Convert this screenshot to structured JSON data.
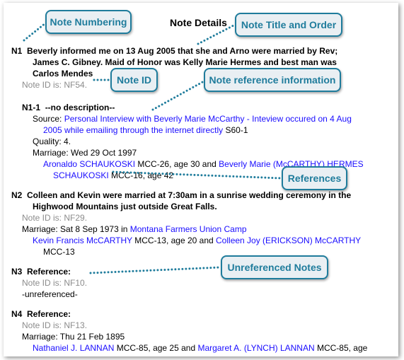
{
  "title": "Note Details",
  "callouts": {
    "numbering": "Note Numbering",
    "title_order": "Note Title and Order",
    "note_id": "Note ID",
    "ref_info": "Note reference information",
    "references": "References",
    "unreferenced": "Unreferenced Notes"
  },
  "colors": {
    "callout_border": "#1f7c9c",
    "callout_fill": "#e9eff3",
    "link": "#1a0dff",
    "note_id": "#8c8c8c"
  },
  "n1": {
    "num": "N1",
    "l1": "Beverly informed me on 13 Aug 2005 that she and Arno were married by Rev;",
    "l2": "James C. Gibney. Maid of Honor was Kelly Marie Hermes and best man was",
    "l3": "Carlos Mendes",
    "id": "Note ID is: NF54.",
    "sub": "N1-1",
    "subdesc": "--no description--",
    "src_label": "Source: ",
    "src1": "Personal Interview with Beverly Marie McCarthy - Inteview occured on 4 Aug",
    "src2": "2005 while emailing through the internet directly",
    "src_id": " S60-1",
    "quality": "Quality: 4.",
    "marriage": "Marriage: Wed 29 Oct 1997",
    "p1": "Aronaldo SCHAUKOSKI",
    "p1info": " MCC-26, age 30 and ",
    "p2a": "Beverly Marie (McCARTHY) HERMES",
    "p2b": "SCHAUKOSKI",
    "p2info": " MCC-16, age 42"
  },
  "n2": {
    "num": "N2",
    "l1": "Colleen and Kevin were married at 7:30am in a sunrise wedding ceremony in the",
    "l2": "Highwood Mountains just outside Great Falls.",
    "id": "Note ID is: NF29.",
    "marriage": "Marriage: Sat 8 Sep 1973 in ",
    "place": "Montana Farmers Union Camp",
    "p1": "Kevin Francis McCARTHY",
    "p1info": " MCC-13, age 20 and ",
    "p2": "Colleen Joy (ERICKSON) McCARTHY",
    "p2info": "MCC-13"
  },
  "n3": {
    "num": "N3",
    "l1": "Reference:",
    "id": "Note ID is: NF10.",
    "unref": "-unreferenced-"
  },
  "n4": {
    "num": "N4",
    "l1": "Reference:",
    "id": "Note ID is: NF13.",
    "marriage": "Marriage: Thu 21 Feb 1895",
    "p1": "Nathaniel J. LANNAN",
    "p1info": " MCC-85, age 25 and ",
    "p2": "Margaret A. (LYNCH) LANNAN",
    "p2info": " MCC-85, age"
  }
}
